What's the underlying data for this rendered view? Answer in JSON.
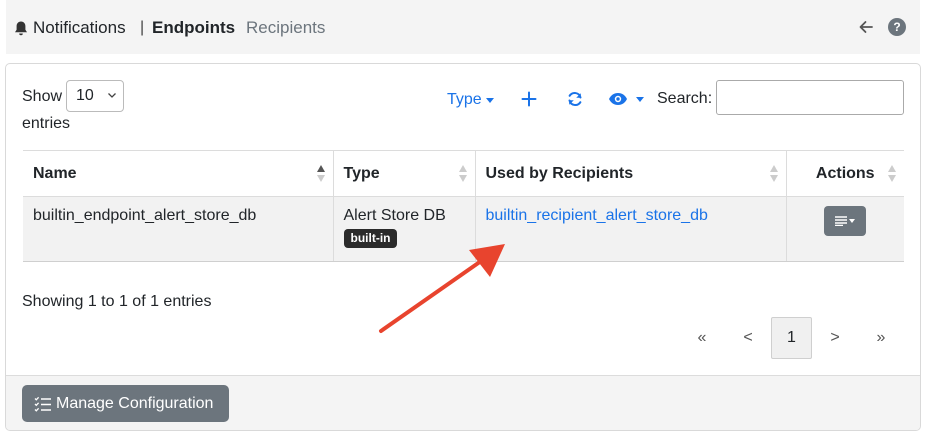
{
  "breadcrumb": {
    "notifications": "Notifications",
    "separator": "|",
    "endpoints": "Endpoints",
    "recipients": "Recipients"
  },
  "header_icons": {
    "back": "arrow-left-icon",
    "help": "question-circle-icon",
    "help_glyph": "?"
  },
  "length_menu": {
    "show_label": "Show",
    "selected": "10",
    "entries_label": "entries"
  },
  "toolbar": {
    "type_label": "Type",
    "add_icon": "plus-icon",
    "refresh_icon": "refresh-icon",
    "visibility_icon": "eye-icon",
    "search_label": "Search:",
    "search_value": ""
  },
  "table": {
    "columns": [
      "Name",
      "Type",
      "Used by Recipients",
      "Actions"
    ],
    "rows": [
      {
        "name": "builtin_endpoint_alert_store_db",
        "type": "Alert Store DB",
        "badge": "built-in",
        "used_by": "builtin_recipient_alert_store_db"
      }
    ]
  },
  "info": "Showing 1 to 1 of 1 entries",
  "pagination": {
    "first": "«",
    "prev": "<",
    "current": "1",
    "next": ">",
    "last": "»"
  },
  "footer": {
    "manage_label": "Manage Configuration"
  },
  "colors": {
    "accent": "#1a73e8",
    "secondary": "#6c757d",
    "annotation_arrow": "#e8442e"
  }
}
